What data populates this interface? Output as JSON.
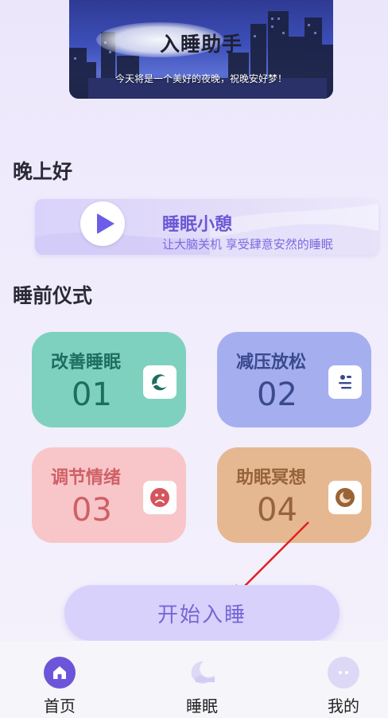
{
  "banner": {
    "title": "入睡助手",
    "subtitle": "今天将是一个美好的夜晚，祝晚安好梦！"
  },
  "greeting": "晚上好",
  "nap_card": {
    "title": "睡眠小憩",
    "subtitle": "让大脑关机 享受肆意安然的睡眠",
    "icon": "play-icon"
  },
  "section_title": "睡前仪式",
  "rituals": [
    {
      "title": "改善睡眠",
      "number": "01",
      "icon": "wave-moon-icon",
      "color": "#7fd1bf"
    },
    {
      "title": "减压放松",
      "number": "02",
      "icon": "relax-list-icon",
      "color": "#a5afef"
    },
    {
      "title": "调节情绪",
      "number": "03",
      "icon": "sad-face-icon",
      "color": "#f8c6c8"
    },
    {
      "title": "助眠冥想",
      "number": "04",
      "icon": "moon-circle-icon",
      "color": "#e6b892"
    }
  ],
  "start_button": "开始入睡",
  "nav": [
    {
      "label": "首页",
      "icon": "home-icon",
      "active": true
    },
    {
      "label": "睡眠",
      "icon": "moon-cloud-icon",
      "active": false
    },
    {
      "label": "我的",
      "icon": "profile-face-icon",
      "active": false
    }
  ],
  "colors": {
    "accent": "#6b5de8",
    "annotation_arrow": "#e0201e"
  }
}
